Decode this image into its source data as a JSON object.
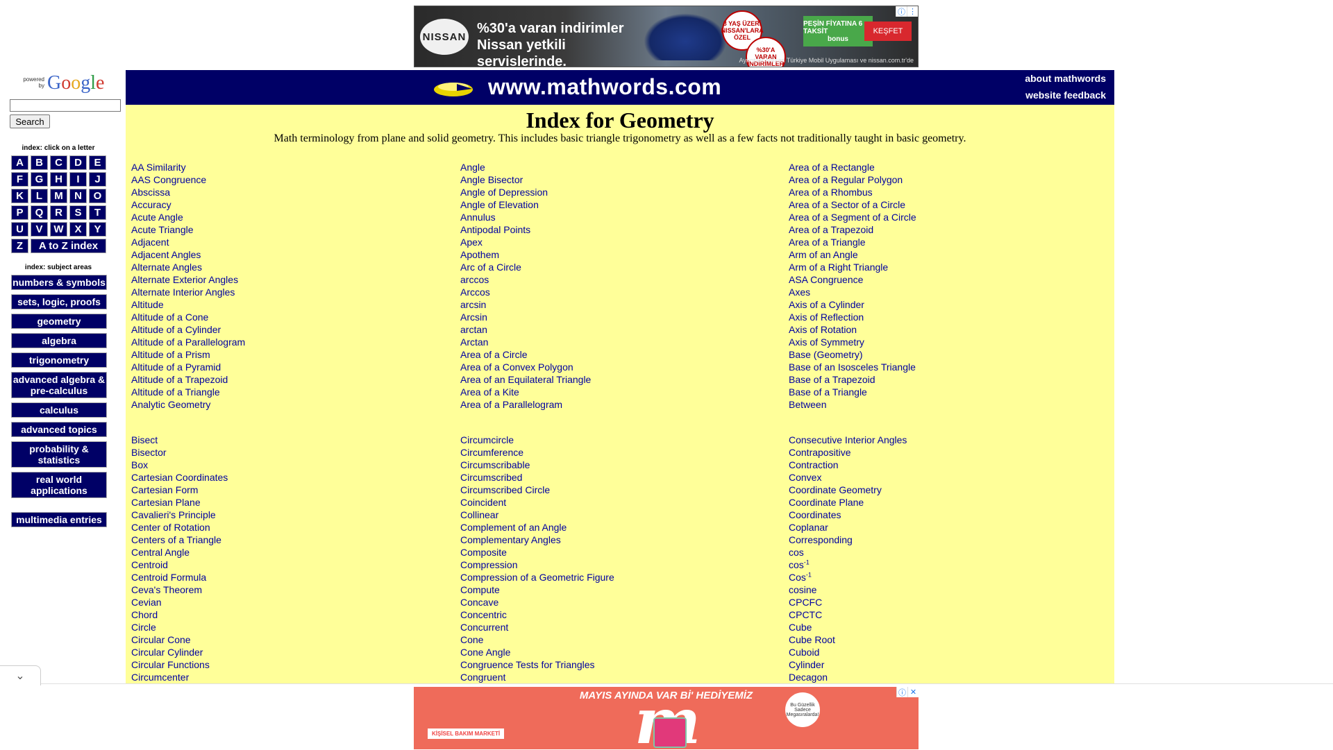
{
  "top_ad": {
    "brand": "NISSAN",
    "headline_line1": "%30'a varan indirimler",
    "headline_line2": "Nissan yetkili servislerinde.",
    "badge1": "3 YAŞ ÜZERİ NISSAN'LARA ÖZEL",
    "badge2": "%30'A VARAN İNDİRİMLER",
    "green_tile_line1": "PEŞİN FİYATINA 6 TAKSİT",
    "green_tile_line2": "bonus",
    "cta": "KEŞFET",
    "fine_print": "Ayrıntılar Nissan Türkiye Mobil Uygulaması ve nissan.com.tr'de"
  },
  "sidebar": {
    "powered_by": "powered by",
    "google_word": "Google",
    "search_button": "Search",
    "letters_caption": "index: click on a letter",
    "letters": [
      "A",
      "B",
      "C",
      "D",
      "E",
      "F",
      "G",
      "H",
      "I",
      "J",
      "K",
      "L",
      "M",
      "N",
      "O",
      "P",
      "Q",
      "R",
      "S",
      "T",
      "U",
      "V",
      "W",
      "X",
      "Y",
      "Z"
    ],
    "a_to_z": "A to Z index",
    "subjects_caption": "index: subject areas",
    "subjects": [
      "numbers & symbols",
      "sets, logic, proofs",
      "geometry",
      "algebra",
      "trigonometry",
      "advanced algebra & pre-calculus",
      "calculus",
      "advanced topics",
      "probability & statistics",
      "real world applications"
    ],
    "multimedia": "multimedia entries"
  },
  "header": {
    "site_title": "www.mathwords.com",
    "about_link": "about mathwords",
    "feedback_link": "website feedback"
  },
  "main": {
    "title": "Index for Geometry",
    "subtitle": "Math terminology from plane and solid geometry. This includes basic triangle trigonometry as well as a few facts not traditionally taught in basic geometry.",
    "group1": {
      "col1": [
        "AA Similarity",
        "AAS Congruence",
        "Abscissa",
        "Accuracy",
        "Acute Angle",
        "Acute Triangle",
        "Adjacent",
        "Adjacent Angles",
        "Alternate Angles",
        "Alternate Exterior Angles",
        "Alternate Interior Angles",
        "Altitude",
        "Altitude of a Cone",
        "Altitude of a Cylinder",
        "Altitude of a Parallelogram",
        "Altitude of a Prism",
        "Altitude of a Pyramid",
        "Altitude of a Trapezoid",
        "Altitude of a Triangle",
        "Analytic Geometry"
      ],
      "col2": [
        "Angle",
        "Angle Bisector",
        "Angle of Depression",
        "Angle of Elevation",
        "Annulus",
        "Antipodal Points",
        "Apex",
        "Apothem",
        "Arc of a Circle",
        "arccos",
        "Arccos",
        "arcsin",
        "Arcsin",
        "arctan",
        "Arctan",
        "Area of a Circle",
        "Area of a Convex Polygon",
        "Area of an Equilateral Triangle",
        "Area of a Kite",
        "Area of a Parallelogram"
      ],
      "col3": [
        "Area of a Rectangle",
        "Area of a Regular Polygon",
        "Area of a Rhombus",
        "Area of a Sector of a Circle",
        "Area of a Segment of a Circle",
        "Area of a Trapezoid",
        "Area of a Triangle",
        "Arm of an Angle",
        "Arm of a Right Triangle",
        "ASA Congruence",
        "Axes",
        "Axis of a Cylinder",
        "Axis of Reflection",
        "Axis of Rotation",
        "Axis of Symmetry",
        "Base (Geometry)",
        "Base of an Isosceles Triangle",
        "Base of a Trapezoid",
        "Base of a Triangle",
        "Between"
      ]
    },
    "group2": {
      "col1": [
        "Bisect",
        "Bisector",
        "Box",
        "Cartesian Coordinates",
        "Cartesian Form",
        "Cartesian Plane",
        "Cavalieri's Principle",
        "Center of Rotation",
        "Centers of a Triangle",
        "Central Angle",
        "Centroid",
        "Centroid Formula",
        "Ceva's Theorem",
        "Cevian",
        "Chord",
        "Circle",
        "Circular Cone",
        "Circular Cylinder",
        "Circular Functions",
        "Circumcenter"
      ],
      "col2": [
        "Circumcircle",
        "Circumference",
        "Circumscribable",
        "Circumscribed",
        "Circumscribed Circle",
        "Coincident",
        "Collinear",
        "Complement of an Angle",
        "Complementary Angles",
        "Composite",
        "Compression",
        "Compression of a Geometric Figure",
        "Compute",
        "Concave",
        "Concentric",
        "Concurrent",
        "Cone",
        "Cone Angle",
        "Congruence Tests for Triangles",
        "Congruent"
      ],
      "col3_a": [
        "Consecutive Interior Angles",
        "Contrapositive",
        "Contraction",
        "Convex",
        "Coordinate Geometry",
        "Coordinate Plane",
        "Coordinates",
        "Coplanar",
        "Corresponding",
        "cos"
      ],
      "cos_inv_lower": "cos",
      "cos_inv_upper": "Cos",
      "superscript": "-1",
      "col3_b": [
        "cosine",
        "CPCFC",
        "CPCTC",
        "Cube",
        "Cube Root",
        "Cuboid",
        "Cylinder",
        "Decagon"
      ]
    }
  },
  "bottom_ad": {
    "promo": "MAYIS AYINDA VAR Bİ' HEDİYEMİZ",
    "store_label": "KİŞİSEL BAKIM MARKETİ",
    "circle_text": "Bu Güzellik Sadece Megasıralarda!"
  },
  "colors": {
    "navy": "#000066",
    "content_bg": "#ffff99",
    "link": "#0000a0"
  }
}
